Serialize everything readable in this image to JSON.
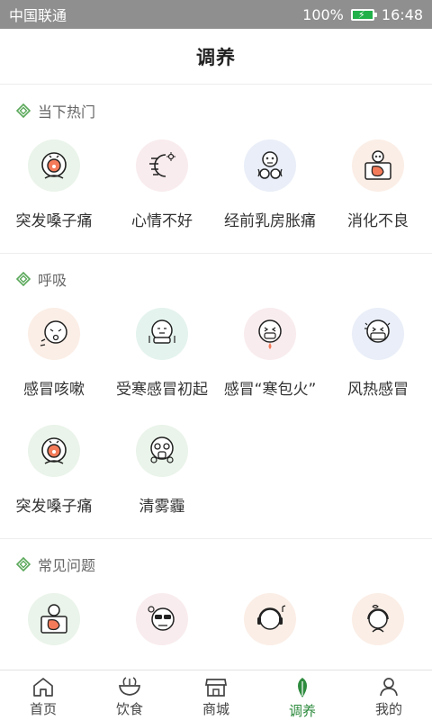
{
  "status_bar": {
    "carrier": "中国联通",
    "battery": "100%",
    "time": "16:48"
  },
  "header": {
    "title": "调养"
  },
  "sections": [
    {
      "title": "当下热门",
      "items": [
        {
          "label": "突发嗓子痛",
          "icon": "sore-throat-icon",
          "bg": "green"
        },
        {
          "label": "心情不好",
          "icon": "bad-mood-icon",
          "bg": "pink"
        },
        {
          "label": "经前乳房胀痛",
          "icon": "breast-pain-icon",
          "bg": "blue"
        },
        {
          "label": "消化不良",
          "icon": "indigestion-icon",
          "bg": "peach"
        }
      ]
    },
    {
      "title": "呼吸",
      "items": [
        {
          "label": "感冒咳嗽",
          "icon": "cough-icon",
          "bg": "peach"
        },
        {
          "label": "受寒感冒初起",
          "icon": "cold-scarf-icon",
          "bg": "mint"
        },
        {
          "label": "感冒“寒包火”",
          "icon": "fever-cold-icon",
          "bg": "pink"
        },
        {
          "label": "风热感冒",
          "icon": "mask-icon",
          "bg": "blue"
        },
        {
          "label": "突发嗓子痛",
          "icon": "sore-throat-icon",
          "bg": "green"
        },
        {
          "label": "清雾霾",
          "icon": "gas-mask-icon",
          "bg": "green"
        }
      ]
    },
    {
      "title": "常见问题",
      "items": [
        {
          "label": "",
          "icon": "stomach-sign-icon",
          "bg": "green"
        },
        {
          "label": "",
          "icon": "sunglasses-icon",
          "bg": "pink"
        },
        {
          "label": "",
          "icon": "headphones-icon",
          "bg": "peach"
        },
        {
          "label": "",
          "icon": "headset-icon",
          "bg": "peach"
        }
      ]
    }
  ],
  "tab_bar": [
    {
      "label": "首页",
      "icon": "home-icon"
    },
    {
      "label": "饮食",
      "icon": "bowl-icon"
    },
    {
      "label": "商城",
      "icon": "shop-icon"
    },
    {
      "label": "调养",
      "icon": "leaf-icon",
      "active": true
    },
    {
      "label": "我的",
      "icon": "user-icon"
    }
  ],
  "colors": {
    "accent": "#2e8b3e",
    "status_bar": "#8f8f8f",
    "diamond": "#5aa85a"
  }
}
